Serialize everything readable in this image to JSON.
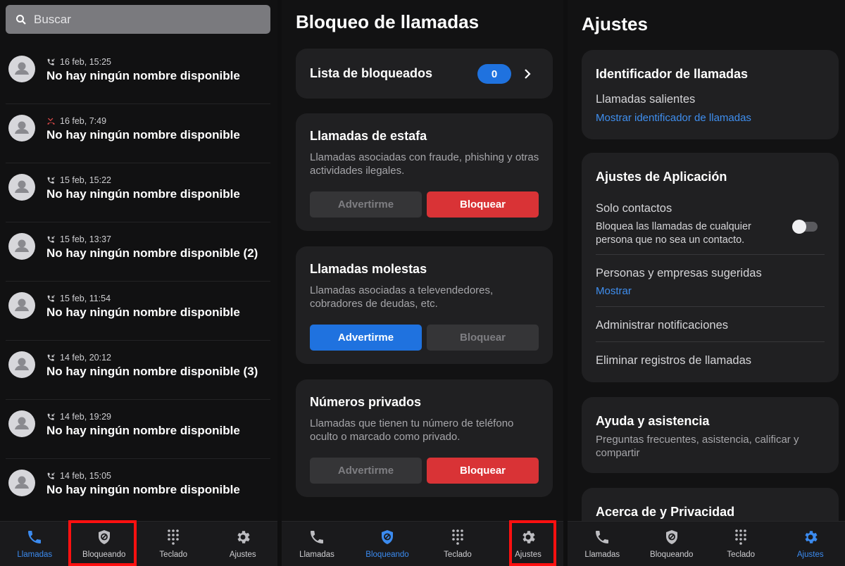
{
  "colors": {
    "accent": "#3b8bf0",
    "block_red": "#d93336",
    "warn_blue": "#1f72df",
    "highlight": "#ff1010",
    "missed": "#e24b4b"
  },
  "search": {
    "placeholder": "Buscar",
    "icon": "search-icon"
  },
  "call_log": [
    {
      "time": "16 feb, 15:25",
      "name": "No hay ningún nombre disponible",
      "type": "incoming"
    },
    {
      "time": "16 feb, 7:49",
      "name": "No hay ningún nombre disponible",
      "type": "missed"
    },
    {
      "time": "15 feb, 15:22",
      "name": "No hay ningún nombre disponible",
      "type": "incoming"
    },
    {
      "time": "15 feb, 13:37",
      "name": "No hay ningún nombre disponible (2)",
      "type": "incoming"
    },
    {
      "time": "15 feb, 11:54",
      "name": "No hay ningún nombre disponible",
      "type": "incoming"
    },
    {
      "time": "14 feb, 20:12",
      "name": "No hay ningún nombre disponible (3)",
      "type": "incoming"
    },
    {
      "time": "14 feb, 19:29",
      "name": "No hay ningún nombre disponible",
      "type": "incoming"
    },
    {
      "time": "14 feb, 15:05",
      "name": "No hay ningún nombre disponible",
      "type": "incoming"
    }
  ],
  "nav": {
    "calls": "Llamadas",
    "blocking": "Bloqueando",
    "keypad": "Teclado",
    "settings": "Ajustes"
  },
  "blocking": {
    "title": "Bloqueo de llamadas",
    "blocked_list": {
      "label": "Lista de bloqueados",
      "count": "0"
    },
    "categories": [
      {
        "title": "Llamadas de estafa",
        "description": "Llamadas asociadas con fraude, phishing y otras actividades ilegales.",
        "warn_label": "Advertirme",
        "block_label": "Bloquear",
        "selected": "block"
      },
      {
        "title": "Llamadas molestas",
        "description": "Llamadas asociadas a televendedores, cobradores de deudas, etc.",
        "warn_label": "Advertirme",
        "block_label": "Bloquear",
        "selected": "warn"
      },
      {
        "title": "Números privados",
        "description": "Llamadas que tienen tu número de teléfono oculto o marcado como privado.",
        "warn_label": "Advertirme",
        "block_label": "Bloquear",
        "selected": "block"
      }
    ]
  },
  "settings": {
    "title": "Ajustes",
    "caller_id": {
      "title": "Identificador de llamadas",
      "outgoing_label": "Llamadas salientes",
      "outgoing_link": "Mostrar identificador de llamadas"
    },
    "app_settings": {
      "title": "Ajustes de Aplicación",
      "contacts_only_label": "Solo contactos",
      "contacts_only_desc": "Bloquea las llamadas de cualquier persona que no sea un contacto.",
      "contacts_only_enabled": false,
      "suggested_label": "Personas y empresas sugeridas",
      "suggested_link": "Mostrar",
      "notifications_label": "Administrar notificaciones",
      "delete_logs_label": "Eliminar registros de llamadas"
    },
    "help": {
      "title": "Ayuda y asistencia",
      "description": "Preguntas frecuentes, asistencia, calificar y compartir"
    },
    "about": {
      "title": "Acerca de y Privacidad"
    }
  }
}
